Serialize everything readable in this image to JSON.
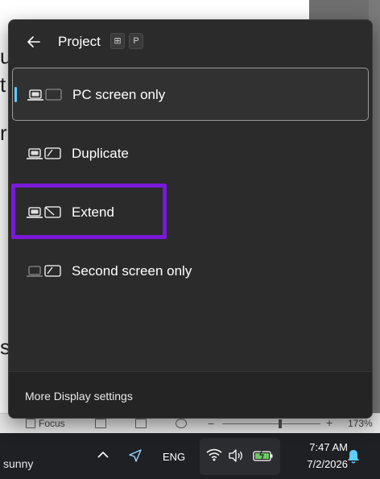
{
  "flyout": {
    "title": "Project",
    "shortcut_keys": [
      "⊞",
      "P"
    ],
    "options": [
      {
        "label": "PC screen only",
        "selected": true,
        "icon": "pc-screen-only-icon"
      },
      {
        "label": "Duplicate",
        "selected": false,
        "icon": "duplicate-icon"
      },
      {
        "label": "Extend",
        "selected": false,
        "icon": "extend-icon"
      },
      {
        "label": "Second screen only",
        "selected": false,
        "icon": "second-screen-only-icon"
      }
    ],
    "footer_link": "More Display settings",
    "accent_color": "#60cdff",
    "highlight_color": "#7a19d8"
  },
  "document": {
    "fragments": [
      "u",
      "t",
      "r",
      "s"
    ]
  },
  "statusbar": {
    "focus_label": "Focus",
    "zoom": "173%"
  },
  "taskbar": {
    "weather": "sunny",
    "language": "ENG",
    "time": "7:47 AM",
    "date": "7/2/2026"
  }
}
